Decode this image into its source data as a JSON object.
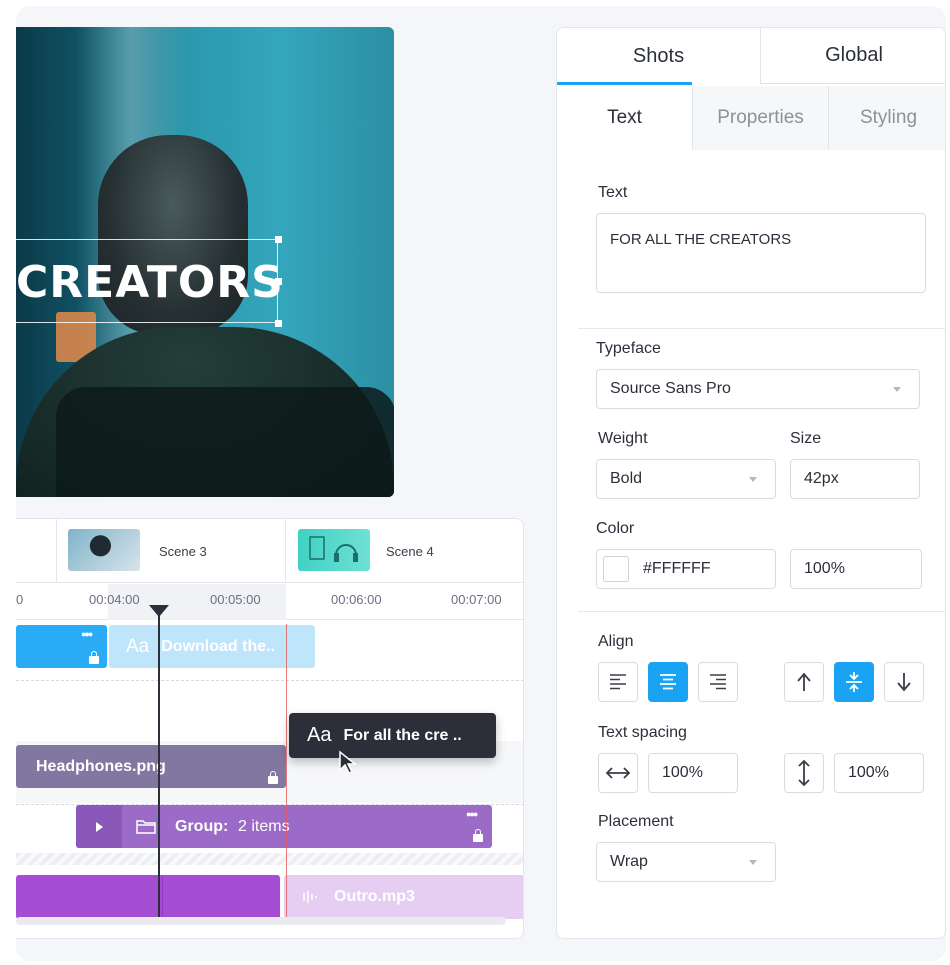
{
  "preview": {
    "headline": "CREATORS"
  },
  "timeline": {
    "scenes": [
      {
        "label": "Scene 3"
      },
      {
        "label": "Scene 4"
      }
    ],
    "ruler_ticks": [
      "0",
      "00:04:00",
      "00:05:00",
      "00:06:00",
      "00:07:00"
    ],
    "clips": {
      "download": {
        "icon": "Aa",
        "label": "Download the.."
      },
      "headphones": {
        "label": "Headphones.png"
      },
      "group": {
        "label": "Group:",
        "count": "2 items"
      },
      "outro": {
        "label": "Outro.mp3"
      }
    },
    "drag_tooltip": {
      "icon": "Aa",
      "label": "For all the cre .."
    }
  },
  "panel": {
    "tabs": [
      {
        "label": "Shots",
        "active": true
      },
      {
        "label": "Global",
        "active": false
      }
    ],
    "subtabs": [
      {
        "label": "Text",
        "active": true
      },
      {
        "label": "Properties",
        "active": false
      },
      {
        "label": "Styling",
        "active": false
      }
    ],
    "text_label": "Text",
    "text_value": "FOR ALL THE CREATORS",
    "typeface_label": "Typeface",
    "typeface_value": "Source Sans Pro",
    "weight_label": "Weight",
    "weight_value": "Bold",
    "size_label": "Size",
    "size_value": "42px",
    "color_label": "Color",
    "color_hex": "#FFFFFF",
    "opacity_value": "100%",
    "align_label": "Align",
    "align_horizontal_selected": "center",
    "align_vertical_selected": "middle",
    "text_spacing_label": "Text spacing",
    "letter_spacing_value": "100%",
    "line_spacing_value": "100%",
    "placement_label": "Placement",
    "placement_value": "Wrap"
  },
  "colors": {
    "accent": "#1aa3f2",
    "text_clip": "#29abf5",
    "image_clip": "#8277a0",
    "group_clip": "#9b6bc7",
    "audio_clip": "#a64ed3"
  }
}
